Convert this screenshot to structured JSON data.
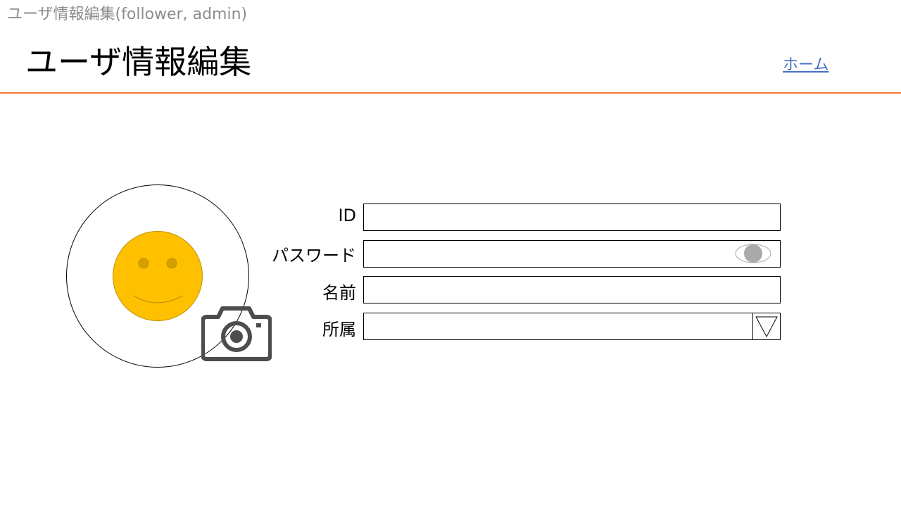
{
  "caption": "ユーザ情報編集(follower, admin)",
  "header": {
    "title": "ユーザ情報編集",
    "home_link": "ホーム"
  },
  "form": {
    "id_label": "ID",
    "id_value": "",
    "password_label": "パスワード",
    "password_value": "",
    "name_label": "名前",
    "name_value": "",
    "affiliation_label": "所属",
    "affiliation_value": ""
  },
  "icons": {
    "avatar": "smiley-face-icon",
    "camera": "camera-icon",
    "eye": "eye-icon",
    "dropdown": "triangle-down-icon"
  },
  "colors": {
    "caption_text": "#8c8c8c",
    "link": "#4472c4",
    "header_rule": "#ed7d31",
    "smiley_fill": "#ffc000",
    "smiley_stroke": "#bf9000",
    "camera": "#4d4d4d",
    "eye_fill": "#aaaaaa"
  }
}
